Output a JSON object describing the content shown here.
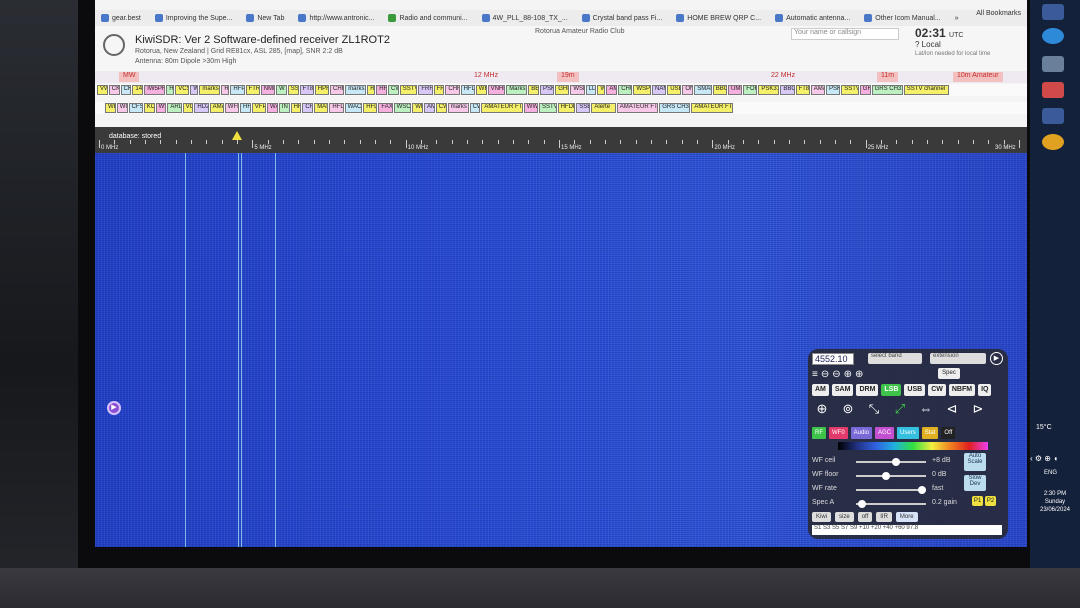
{
  "bookmarks": {
    "items": [
      "gear.best",
      "Improving the Supe...",
      "New Tab",
      "http://www.antronic...",
      "Radio and communi...",
      "4W_PLL_88-108_TX_...",
      "Crystal band pass Fi...",
      "HOME BREW QRP C...",
      "Automatic antenna...",
      "Other Icom Manual..."
    ],
    "overflow": "»",
    "all_label": "All Bookmarks"
  },
  "header": {
    "title": "KiwiSDR: Ver 2 Software-defined receiver ZL1ROT2",
    "subtitle": "Rotorua, New Zealand | Grid RE81cx, ASL 285, [map], SNR 2:2 dB",
    "antenna": "Antenna: 80m Dipole >30m High",
    "club": "Rotorua Amateur Radio Club",
    "callsign_placeholder": "Your name or callsign",
    "clock": "02:31",
    "clock_tz": "UTC",
    "local": "? Local",
    "local_note": "Lat/lon needed for local time"
  },
  "bands": [
    "MW",
    "12 MHz",
    "19m",
    "22 MHz",
    "11m",
    "10m Amateur"
  ],
  "rows": {
    "row1": [
      "VW",
      "CK",
      "CK",
      "14",
      "IW5PR",
      "H",
      "VCS",
      "W",
      "marks",
      "R",
      "HFP",
      "FTR",
      "NMR",
      "WT",
      "SS",
      "FT8",
      "HPR",
      "CHF",
      "marks",
      "R",
      "HF",
      "CW",
      "SSTV",
      "FRH",
      "FR",
      "CHF",
      "HFD",
      "WR",
      "VNHF",
      "Marks",
      "BE",
      "PSK",
      "GHL",
      "WSF",
      "LL",
      "W",
      "AM",
      "CHU",
      "WSPR",
      "NAM",
      "USB",
      "ON",
      "SMAB",
      "BBC",
      "UMB",
      "FOK",
      "PSK31",
      "BBC",
      "FT8",
      "AMA",
      "PSK",
      "SSTV",
      "GR",
      "GRS CH31",
      "SSTV channel"
    ],
    "row2": [
      "WE",
      "WC",
      "CFS",
      "KC",
      "WV",
      "ARD",
      "VO",
      "HD2",
      "AMA",
      "WFM",
      "HF",
      "VFP",
      "WA",
      "IN",
      "HF",
      "CH",
      "MAR",
      "HFD",
      "WACR",
      "HFD",
      "FAX",
      "WSCB",
      "WR",
      "AM",
      "CW",
      "marks",
      "CW",
      "AMATEUR FT8",
      "WWV",
      "SSTV",
      "HFDL",
      "SSB",
      "Alerte",
      "AMATEUR FT8",
      "GRS CH31",
      "AMATEUR FT8"
    ]
  },
  "scale": {
    "db": "database: stored",
    "labels": [
      "0 MHz",
      "5 MHz",
      "10 MHz",
      "15 MHz",
      "20 MHz",
      "25 MHz",
      "30 MHz"
    ]
  },
  "panel": {
    "freq": "4552.10",
    "band_select": "select band",
    "extension_select": "extension",
    "spec": "Spec",
    "modes": [
      "AM",
      "SAM",
      "DRM",
      "LSB",
      "USB",
      "CW",
      "NBFM",
      "IQ"
    ],
    "active_mode": "LSB",
    "tabs": [
      "RF",
      "WF0",
      "Audio",
      "AGC",
      "Users",
      "Stat",
      "Off"
    ],
    "wf_ceil": "WF ceil",
    "wf_ceil_val": "+8 dB",
    "wf_floor": "WF floor",
    "wf_floor_val": "0 dB",
    "wf_rate": "WF rate",
    "wf_rate_val": "fast",
    "spec_a": "Spec A",
    "spec_a_val": "0.2 gain",
    "auto_scale": "Auto Scale",
    "slow_dev": "Slow Dev",
    "p1": "P1",
    "p2": "P2",
    "bottom": [
      "Kiwi",
      "size",
      "off",
      "IIR"
    ],
    "more": "More",
    "smeter": "S1  S3  S5  S7  S9 +10 +20  +40  +60  97.8"
  },
  "taskbar": {
    "temp": "15°C",
    "lang": "ENG",
    "time": "2:30 PM",
    "day": "Sunday",
    "date": "23/06/2024"
  }
}
